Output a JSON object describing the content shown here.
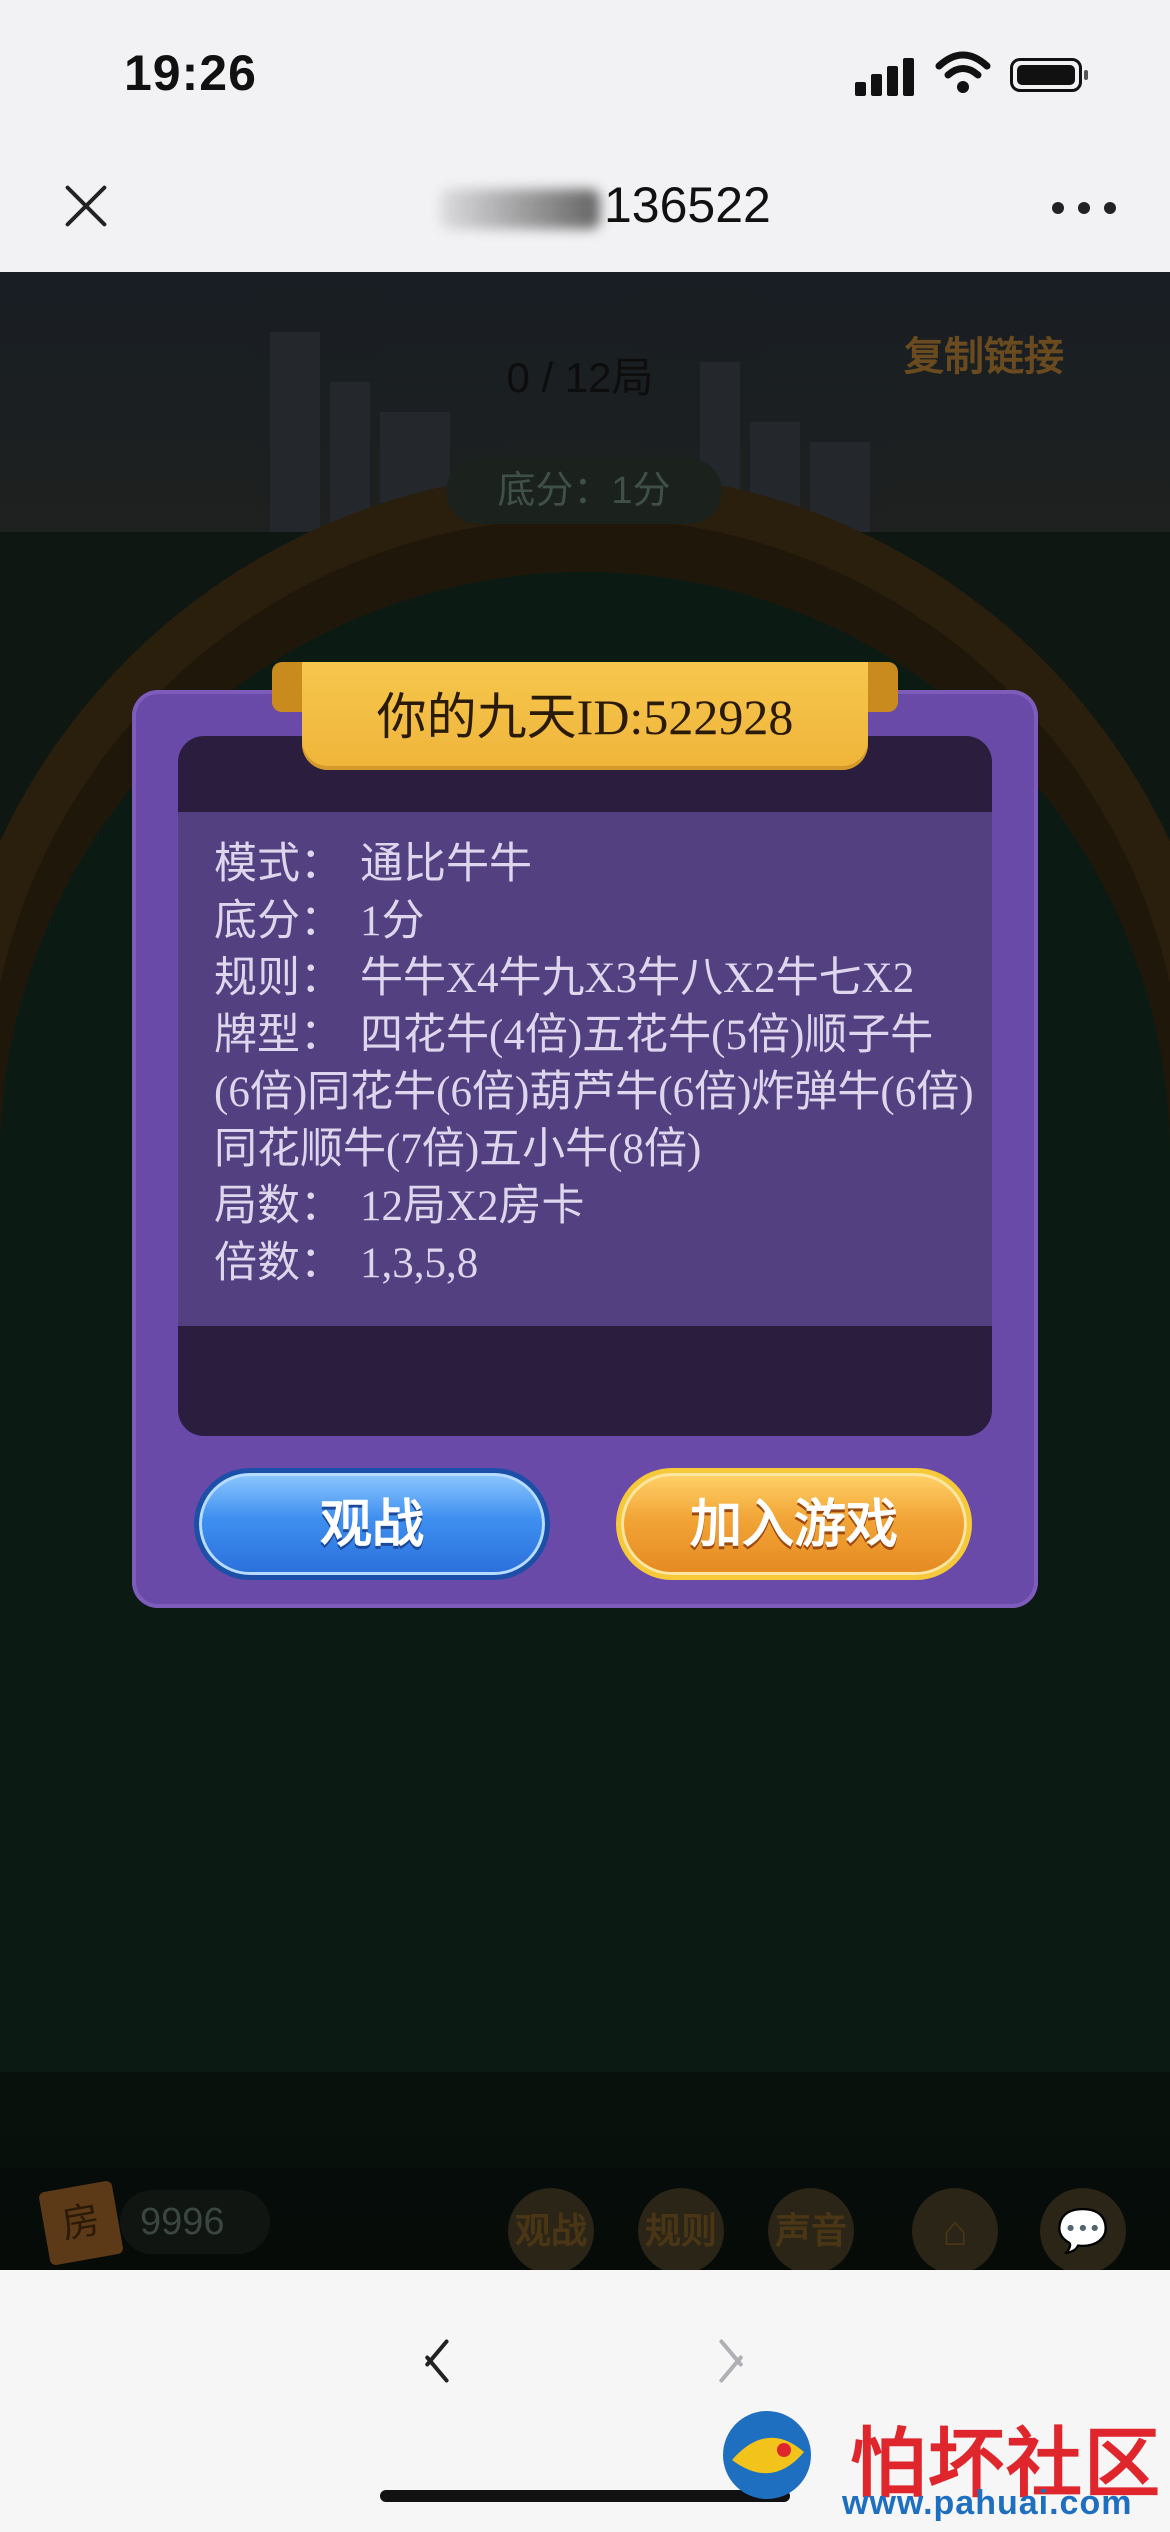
{
  "status_bar": {
    "time": "19:26"
  },
  "nav": {
    "title": "136522"
  },
  "game": {
    "round_progress": "0 / 12局",
    "copy_link": "复制链接",
    "base_score": "底分：1分",
    "room_card_icon": "房",
    "room_card_count": "9996",
    "toolbar": {
      "watch": "观战",
      "rules": "规则",
      "sound": "声音"
    }
  },
  "dialog": {
    "title": "你的九天ID:522928",
    "rows": [
      {
        "label": "模式：",
        "value": "通比牛牛"
      },
      {
        "label": "底分：",
        "value": "1分"
      },
      {
        "label": "规则：",
        "value": "牛牛X4牛九X3牛八X2牛七X2"
      },
      {
        "label": "牌型：",
        "value": "四花牛(4倍)五花牛(5倍)顺子牛",
        "continuation": "(6倍)同花牛(6倍)葫芦牛(6倍)炸弹牛(6倍)同花顺牛(7倍)五小牛(8倍)"
      },
      {
        "label": "局数：",
        "value": "12局X2房卡"
      },
      {
        "label": "倍数：",
        "value": "1,3,5,8"
      }
    ],
    "watch_button": "观战",
    "join_button": "加入游戏"
  },
  "watermark": {
    "title": "怕坏社区",
    "url": "www.pahuai.com"
  },
  "colors": {
    "dialog_purple": "#6a4aa8",
    "ribbon_gold": "#f2bc45",
    "button_blue": "#3e8ff0",
    "button_orange": "#f2a436",
    "watermark_red": "#e0262d"
  }
}
